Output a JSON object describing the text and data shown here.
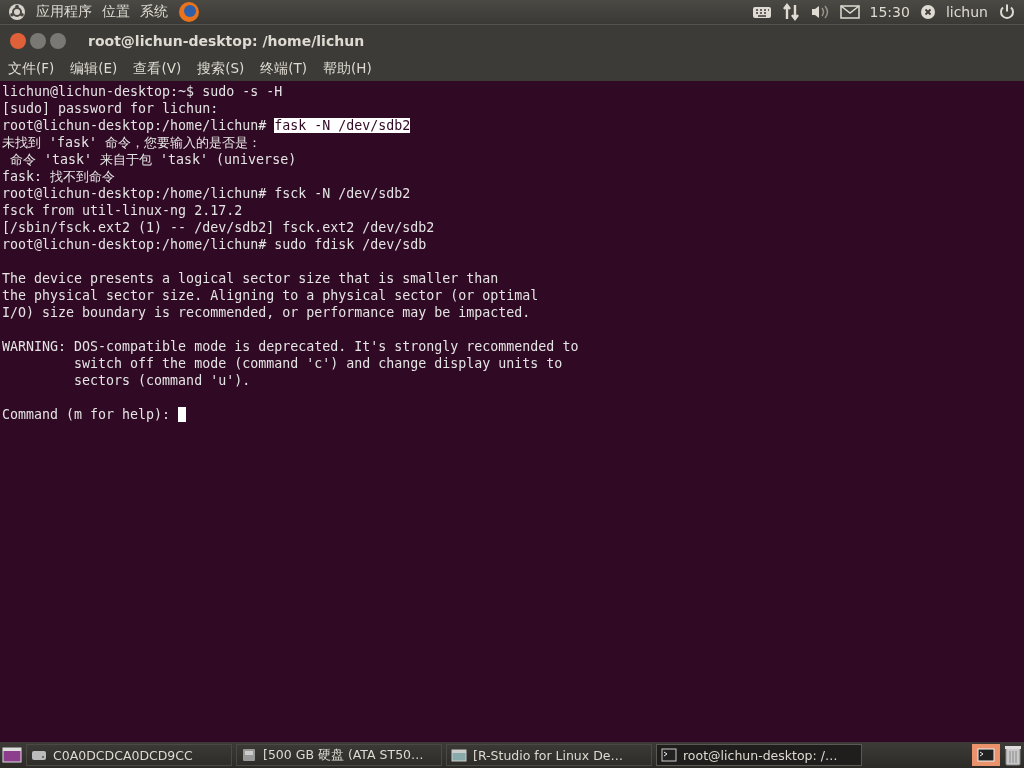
{
  "top_panel": {
    "menus": [
      "应用程序",
      "位置",
      "系统"
    ],
    "clock": "15:30",
    "user": "lichun"
  },
  "window": {
    "title": "root@lichun-desktop: /home/lichun"
  },
  "menubar": [
    "文件(F)",
    "编辑(E)",
    "查看(V)",
    "搜索(S)",
    "终端(T)",
    "帮助(H)"
  ],
  "terminal": {
    "lines": [
      {
        "kind": "text",
        "text": "lichun@lichun-desktop:~$ sudo -s -H"
      },
      {
        "kind": "text",
        "text": "[sudo] password for lichun:"
      },
      {
        "kind": "selection",
        "text": "root@lichun-desktop:/home/lichun# ",
        "selected_text": "fask -N /dev/sdb2"
      },
      {
        "kind": "text",
        "text": "未找到 'fask' 命令，您要输入的是否是："
      },
      {
        "kind": "text",
        "text": " 命令 'task' 来自于包 'task' (universe)"
      },
      {
        "kind": "text",
        "text": "fask: 找不到命令"
      },
      {
        "kind": "text",
        "text": "root@lichun-desktop:/home/lichun# fsck -N /dev/sdb2"
      },
      {
        "kind": "text",
        "text": "fsck from util-linux-ng 2.17.2"
      },
      {
        "kind": "text",
        "text": "[/sbin/fsck.ext2 (1) -- /dev/sdb2] fsck.ext2 /dev/sdb2"
      },
      {
        "kind": "text",
        "text": "root@lichun-desktop:/home/lichun# sudo fdisk /dev/sdb"
      },
      {
        "kind": "blank"
      },
      {
        "kind": "text",
        "text": "The device presents a logical sector size that is smaller than"
      },
      {
        "kind": "text",
        "text": "the physical sector size. Aligning to a physical sector (or optimal"
      },
      {
        "kind": "text",
        "text": "I/O) size boundary is recommended, or performance may be impacted."
      },
      {
        "kind": "blank"
      },
      {
        "kind": "text",
        "text": "WARNING: DOS-compatible mode is deprecated. It's strongly recommended to"
      },
      {
        "kind": "text",
        "text": "         switch off the mode (command 'c') and change display units to"
      },
      {
        "kind": "text",
        "text": "         sectors (command 'u')."
      },
      {
        "kind": "blank"
      },
      {
        "kind": "cursor",
        "text": "Command (m for help): "
      }
    ]
  },
  "taskbar": {
    "tasks": [
      {
        "label": "C0A0DCDCA0DCD9CC",
        "kind": "drive",
        "selected": false
      },
      {
        "label": "[500 GB 硬盘 (ATA ST50…",
        "kind": "disk",
        "selected": false
      },
      {
        "label": "[R-Studio for Linux De…",
        "kind": "window",
        "selected": false
      },
      {
        "label": "root@lichun-desktop: /…",
        "kind": "terminal",
        "selected": true
      }
    ]
  }
}
